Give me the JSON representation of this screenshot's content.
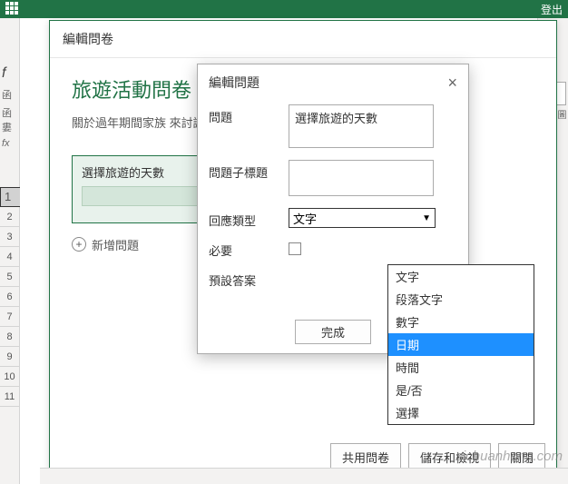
{
  "topbar": {
    "logout": "登出"
  },
  "sidebar": {
    "fx": "f",
    "fx_sub1": "函",
    "fx_sub2": "函婁",
    "fx_note": "fx",
    "rows": [
      "1",
      "2",
      "3",
      "4",
      "5",
      "6",
      "7",
      "8",
      "9",
      "10",
      "11"
    ]
  },
  "right": {
    "label": "其他圖"
  },
  "panel1": {
    "header": "編輯問卷",
    "title": "旅遊活動問卷",
    "desc": "關於過年期間家族\n來討論。",
    "question_label": "選擇旅遊的天數",
    "add_question": "新增問題",
    "footer": {
      "share": "共用問卷",
      "save": "儲存和檢視",
      "close": "關閉"
    }
  },
  "dialog": {
    "title": "編輯問題",
    "fields": {
      "question_label": "問題",
      "question_value": "選擇旅遊的天數",
      "subtitle_label": "問題子標題",
      "subtitle_value": "",
      "type_label": "回應類型",
      "type_value": "文字",
      "required_label": "必要",
      "default_label": "預設答案"
    },
    "dropdown_options": [
      "文字",
      "段落文字",
      "數字",
      "日期",
      "時間",
      "是/否",
      "選擇"
    ],
    "dropdown_highlighted_index": 3,
    "done": "完成"
  },
  "watermark": "sichuanhong.com"
}
